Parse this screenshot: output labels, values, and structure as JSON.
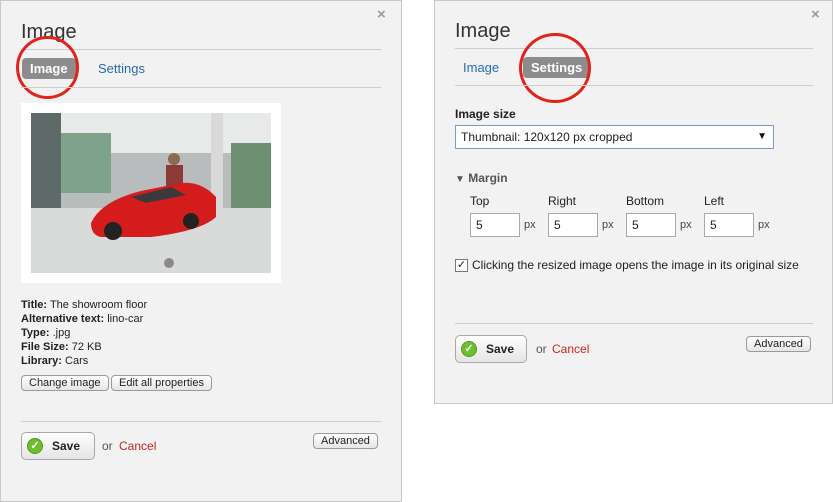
{
  "left_panel": {
    "title": "Image",
    "close_glyph": "×",
    "tabs": [
      {
        "label": "Image",
        "active": true
      },
      {
        "label": "Settings",
        "active": false
      }
    ],
    "image_info": [
      {
        "label": "Title:",
        "value": "The showroom floor"
      },
      {
        "label": "Alternative text:",
        "value": "lino-car"
      },
      {
        "label": "Type:",
        "value": ".jpg"
      },
      {
        "label": "File Size:",
        "value": "72 KB"
      },
      {
        "label": "Library:",
        "value": "Cars"
      }
    ],
    "change_image_label": "Change image",
    "edit_properties_label": "Edit all properties",
    "save_label": "Save",
    "or_label": "or",
    "cancel_label": "Cancel",
    "advanced_label": "Advanced"
  },
  "right_panel": {
    "title": "Image",
    "close_glyph": "×",
    "tabs": [
      {
        "label": "Image",
        "active": false
      },
      {
        "label": "Settings",
        "active": true
      }
    ],
    "image_size_label": "Image size",
    "image_size_value": "Thumbnail: 120x120 px cropped",
    "margin_label": "Margin",
    "margins": [
      {
        "label": "Top",
        "value": "5",
        "unit": "px"
      },
      {
        "label": "Right",
        "value": "5",
        "unit": "px"
      },
      {
        "label": "Bottom",
        "value": "5",
        "unit": "px"
      },
      {
        "label": "Left",
        "value": "5",
        "unit": "px"
      }
    ],
    "open_original_checked": true,
    "open_original_label": "Clicking the resized image opens the image in its original size",
    "save_label": "Save",
    "or_label": "or",
    "cancel_label": "Cancel",
    "advanced_label": "Advanced"
  },
  "colors": {
    "panel_bg": "#f2f2f2",
    "link": "#2a6bb0",
    "cancel": "#c9251f",
    "active_tab": "#8c8c8c",
    "highlight_circle": "#e2231a",
    "save_check": "#6cbf2e"
  }
}
